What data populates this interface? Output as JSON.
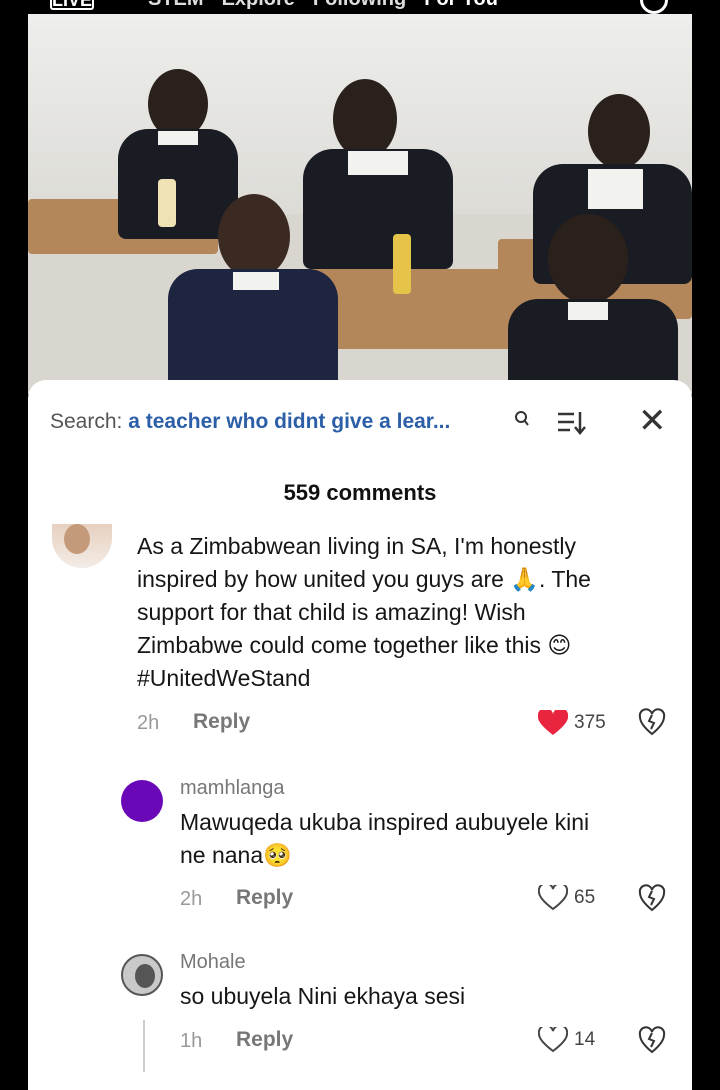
{
  "topnav": {
    "live": "LIVE",
    "tabs": [
      "STEM",
      "Explore",
      "Following",
      "For You"
    ]
  },
  "search": {
    "label": "Search:",
    "query": "a teacher who didnt give a lear..."
  },
  "comments_count": "559 comments",
  "comments": [
    {
      "text_lines": [
        "As a Zimbabwean living in SA, I'm honestly",
        "inspired by how united you guys are 🙏. The",
        "support for that child is amazing! Wish",
        "Zimbabwe could come together like this 😊",
        "#UnitedWeStand"
      ],
      "time": "2h",
      "reply_label": "Reply",
      "likes": "375",
      "liked": true
    },
    {
      "username": "mamhlanga",
      "text_lines": [
        "Mawuqeda ukuba inspired aubuyele kini",
        "ne nana🥺"
      ],
      "time": "2h",
      "reply_label": "Reply",
      "likes": "65",
      "liked": false
    },
    {
      "username": "Mohale",
      "text_lines": [
        "so ubuyela Nini ekhaya sesi"
      ],
      "time": "1h",
      "reply_label": "Reply",
      "likes": "14",
      "liked": false
    }
  ],
  "colors": {
    "heart_red": "#e8243f",
    "search_query_blue": "#2d5fa8",
    "avatar_purple": "#6a08b8"
  },
  "icons": [
    "search-icon",
    "sort-icon",
    "close-icon",
    "heart-icon",
    "dislike-icon"
  ]
}
